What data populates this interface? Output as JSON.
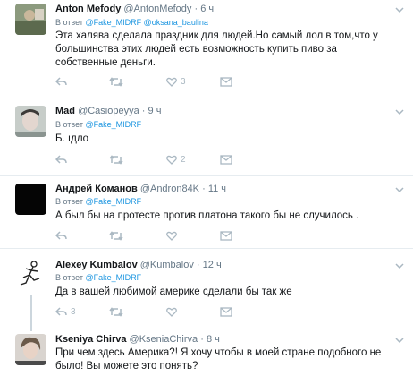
{
  "tweets": [
    {
      "name": "Anton Mefody",
      "handle": "@AntonMefody",
      "time": "6 ч",
      "reply_prefix": "В ответ",
      "mentions": [
        "@Fake_MIDRF",
        "@oksana_baulina"
      ],
      "text": "Эта халява сделала праздник для людей.Но самый лол в том,что у большинства этих людей есть возможность купить пиво за собственные деньги.",
      "reply_count": "",
      "retweet_count": "",
      "like_count": "3"
    },
    {
      "name": "Mad",
      "handle": "@Casiopeyya",
      "time": "9 ч",
      "reply_prefix": "В ответ",
      "mentions": [
        "@Fake_MIDRF"
      ],
      "text": "Б. ıдло",
      "reply_count": "",
      "retweet_count": "",
      "like_count": "2"
    },
    {
      "name": "Андрей Команов",
      "handle": "@Andron84K",
      "time": "11 ч",
      "reply_prefix": "В ответ",
      "mentions": [
        "@Fake_MIDRF"
      ],
      "text": "А был бы на протесте против платона такого бы не случилось .",
      "reply_count": "",
      "retweet_count": "",
      "like_count": ""
    },
    {
      "name": "Alexey Kumbalov",
      "handle": "@Kumbalov",
      "time": "12 ч",
      "reply_prefix": "В ответ",
      "mentions": [
        "@Fake_MIDRF"
      ],
      "text": "Да в вашей любимой америке сделали бы так же",
      "reply_count": "3",
      "retweet_count": "",
      "like_count": ""
    },
    {
      "name": "Kseniya Chirva",
      "handle": "@KseniaChirva",
      "time": "8 ч",
      "reply_prefix": "",
      "mentions": [],
      "text": "При чем здесь Америка?! Я хочу чтобы в моей стране подобного не было! Вы можете это понять?",
      "reply_count": "",
      "retweet_count": "",
      "like_count": ""
    }
  ],
  "separator": "·",
  "colors": {
    "text": "#14171a",
    "muted": "#657786",
    "link": "#1b95e0",
    "icon": "#aab8c2",
    "divider": "#e6ecf0",
    "thread": "#ccd6dd"
  },
  "icons": [
    "reply-icon",
    "retweet-icon",
    "like-icon",
    "dm-icon",
    "chevron-down-icon"
  ]
}
